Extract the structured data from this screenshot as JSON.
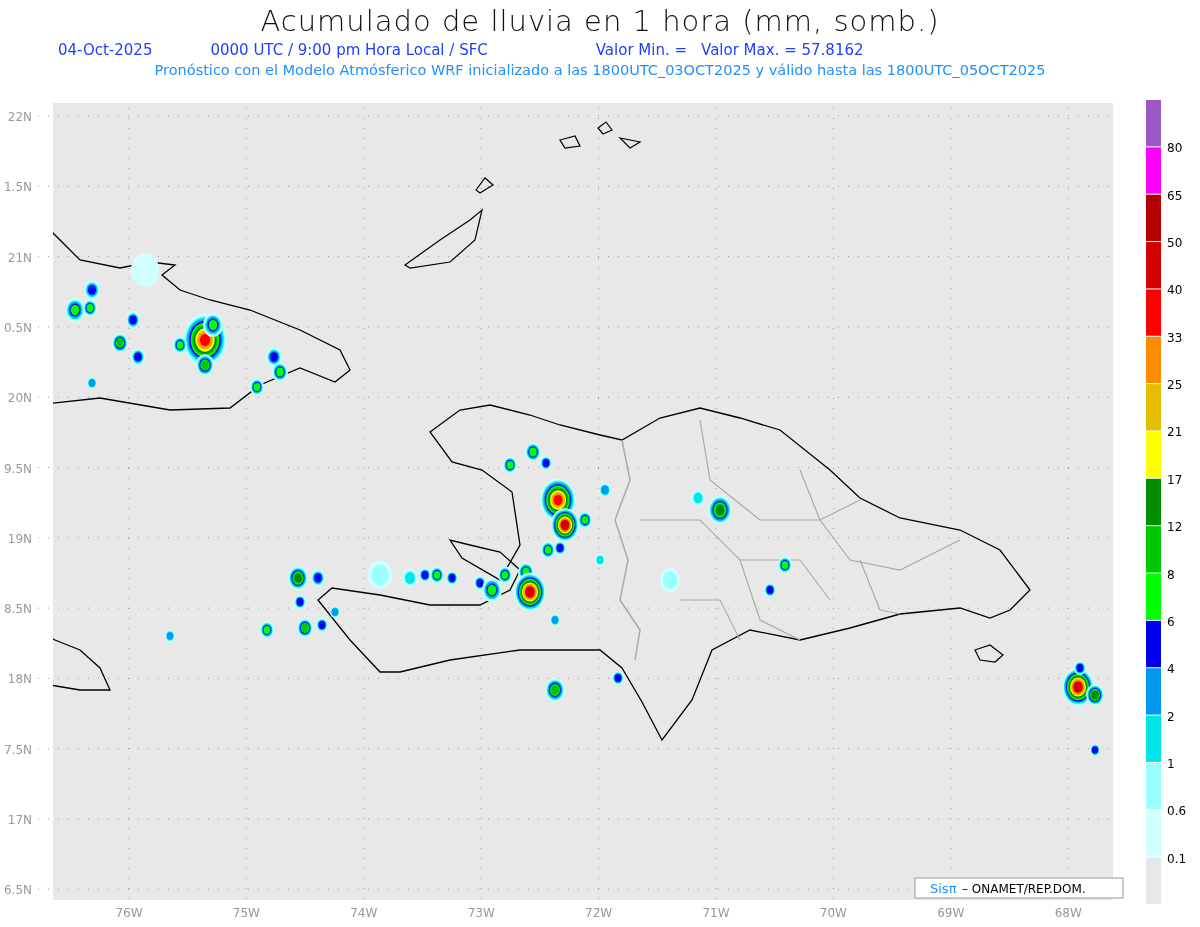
{
  "title": "Acumulado de lluvia en 1 hora (mm, somb.)",
  "info": {
    "date": "04-Oct-2025",
    "time": "0000 UTC / 9:00 pm Hora Local / SFC",
    "valor_min": "Valor Min. =",
    "valor_max": "Valor Max. = 57.8162"
  },
  "subtitle": "Pronóstico con el Modelo Atmósferico WRF inicializado a las 1800UTC_03OCT2025 y válido hasta las  1800UTC_05OCT2025",
  "y_axis": {
    "labels": [
      "22N",
      "1.5N",
      "21N",
      "0.5N",
      "20N",
      "9.5N",
      "19N",
      "8.5N",
      "18N",
      "7.5N",
      "17N",
      "6.5N"
    ]
  },
  "x_axis": {
    "labels": [
      "76W",
      "75W",
      "74W",
      "73W",
      "72W",
      "71W",
      "70W",
      "69W",
      "68W"
    ]
  },
  "colorbar": {
    "segments": [
      {
        "color": "#9b59c8"
      },
      {
        "color": "#ff00ff",
        "label": "80"
      },
      {
        "color": "#b40000",
        "label": "65"
      },
      {
        "color": "#d20000",
        "label": "50"
      },
      {
        "color": "#ff0000",
        "label": "40"
      },
      {
        "color": "#ff8c00",
        "label": "33"
      },
      {
        "color": "#e6be00",
        "label": "25"
      },
      {
        "color": "#ffff00",
        "label": "21"
      },
      {
        "color": "#008c00",
        "label": "17"
      },
      {
        "color": "#00c800",
        "label": "12"
      },
      {
        "color": "#00ff00",
        "label": "8"
      },
      {
        "color": "#0000f0",
        "label": "6"
      },
      {
        "color": "#0099f0",
        "label": "4"
      },
      {
        "color": "#00e6e6",
        "label": "2"
      },
      {
        "color": "#99ffff",
        "label": "1"
      },
      {
        "color": "#d0ffff",
        "label": "0.6"
      },
      {
        "color": "#e8e8e8",
        "label": "0.1"
      }
    ]
  },
  "credit": {
    "brand": "Sisπ",
    "text": "– ONAMET/REP.DOM."
  }
}
